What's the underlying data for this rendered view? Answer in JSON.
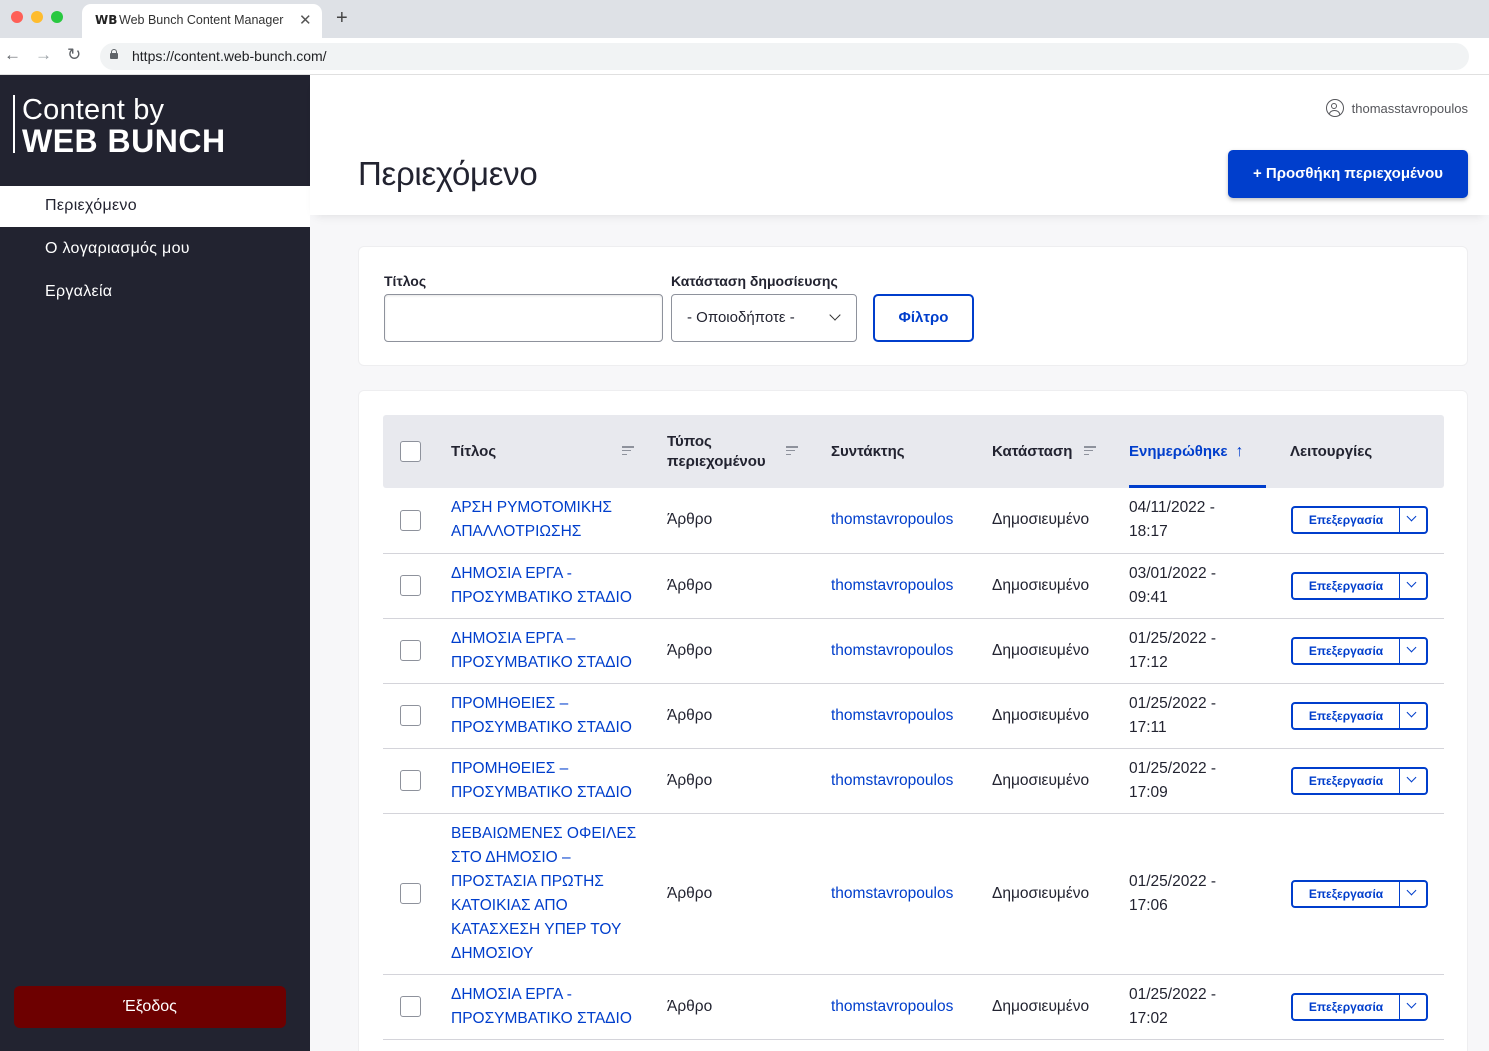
{
  "browser": {
    "tab_title": "Web Bunch Content Manager",
    "tab_favicon": "WB",
    "url": "https://content.web-bunch.com/"
  },
  "sidebar": {
    "logo_line1": "Content by",
    "logo_line2": "WEB BUNCH",
    "items": [
      {
        "label": "Περιεχόμενο",
        "active": true
      },
      {
        "label": "Ο λογαριασμός μου",
        "active": false
      },
      {
        "label": "Εργαλεία",
        "active": false
      }
    ],
    "logout_label": "Έξοδος"
  },
  "header": {
    "username": "thomasstavropoulos",
    "page_title": "Περιεχόμενο",
    "add_button": "+ Προσθήκη περιεχομένου"
  },
  "filters": {
    "title_label": "Τίτλος",
    "title_value": "",
    "status_label": "Κατάσταση δημοσίευσης",
    "status_value": "- Οποιοδήποτε -",
    "filter_button": "Φίλτρο"
  },
  "table": {
    "columns": {
      "title": "Τίτλος",
      "type_line1": "Τύπος",
      "type_line2": "περιεχομένου",
      "author": "Συντάκτης",
      "status": "Κατάσταση",
      "updated": "Ενημερώθηκε",
      "operations": "Λειτουργίες"
    },
    "sorted_column": "updated",
    "sort_direction": "ascending",
    "edit_label": "Επεξεργασία",
    "rows": [
      {
        "title_lines": [
          "ΑΡΣΗ ΡΥΜΟΤΟΜΙΚΗΣ",
          "ΑΠΑΛΛΟΤΡΙΩΣΗΣ"
        ],
        "type": "Άρθρο",
        "author": "thomstavropoulos",
        "status": "Δημοσιευμένο",
        "date": "04/11/2022 -",
        "time": "18:17"
      },
      {
        "title_lines": [
          "ΔΗΜΟΣΙΑ ΕΡΓΑ -",
          "ΠΡΟΣΥΜΒΑΤΙΚΟ ΣΤΑΔΙΟ"
        ],
        "type": "Άρθρο",
        "author": "thomstavropoulos",
        "status": "Δημοσιευμένο",
        "date": "03/01/2022 -",
        "time": "09:41"
      },
      {
        "title_lines": [
          "ΔΗΜΟΣΙΑ ΕΡΓΑ –",
          "ΠΡΟΣΥΜΒΑΤΙΚΟ ΣΤΑΔΙΟ"
        ],
        "type": "Άρθρο",
        "author": "thomstavropoulos",
        "status": "Δημοσιευμένο",
        "date": "01/25/2022 -",
        "time": "17:12"
      },
      {
        "title_lines": [
          "ΠΡΟΜΗΘΕΙΕΣ –",
          "ΠΡΟΣΥΜΒΑΤΙΚΟ ΣΤΑΔΙΟ"
        ],
        "type": "Άρθρο",
        "author": "thomstavropoulos",
        "status": "Δημοσιευμένο",
        "date": "01/25/2022 -",
        "time": "17:11"
      },
      {
        "title_lines": [
          "ΠΡΟΜΗΘΕΙΕΣ –",
          "ΠΡΟΣΥΜΒΑΤΙΚΟ ΣΤΑΔΙΟ"
        ],
        "type": "Άρθρο",
        "author": "thomstavropoulos",
        "status": "Δημοσιευμένο",
        "date": "01/25/2022 -",
        "time": "17:09"
      },
      {
        "title_lines": [
          "ΒΕΒΑΙΩΜΕΝΕΣ ΟΦΕΙΛΕΣ",
          "ΣΤΟ ΔΗΜΟΣΙΟ –",
          "ΠΡΟΣΤΑΣΙΑ ΠΡΩΤΗΣ",
          "ΚΑΤΟΙΚΙΑΣ ΑΠΟ",
          "ΚΑΤΑΣΧΕΣΗ ΥΠΕΡ ΤΟΥ",
          "ΔΗΜΟΣΙΟΥ"
        ],
        "type": "Άρθρο",
        "author": "thomstavropoulos",
        "status": "Δημοσιευμένο",
        "date": "01/25/2022 -",
        "time": "17:06"
      },
      {
        "title_lines": [
          "ΔΗΜΟΣΙΑ ΕΡΓΑ -",
          "ΠΡΟΣΥΜΒΑΤΙΚΟ ΣΤΑΔΙΟ"
        ],
        "type": "Άρθρο",
        "author": "thomstavropoulos",
        "status": "Δημοσιευμένο",
        "date": "01/25/2022 -",
        "time": "17:02"
      }
    ]
  },
  "colors": {
    "accent": "#003ecc",
    "sidebar_bg": "#222330",
    "logout_bg": "#6d0000"
  }
}
